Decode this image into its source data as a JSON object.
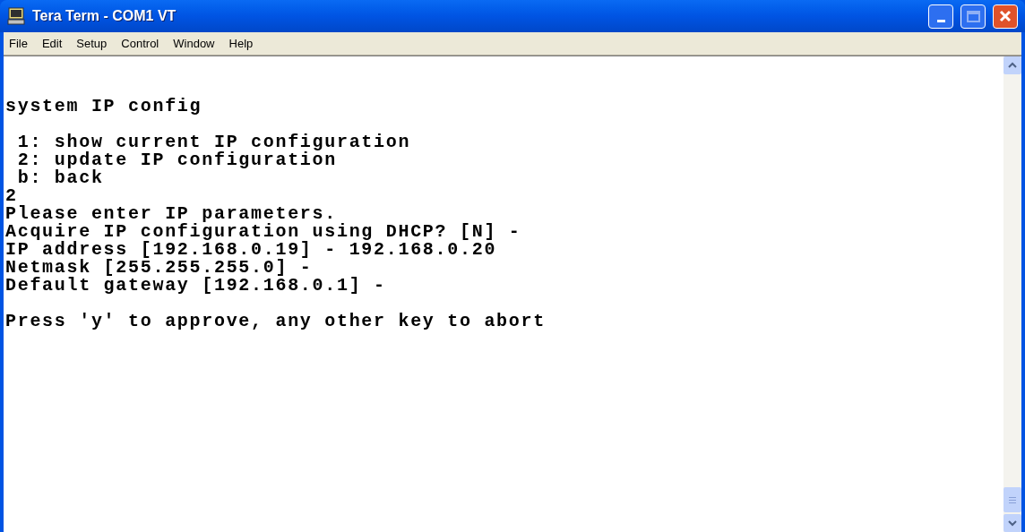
{
  "window": {
    "title": "Tera Term - COM1 VT"
  },
  "menu": [
    "File",
    "Edit",
    "Setup",
    "Control",
    "Window",
    "Help"
  ],
  "terminal": {
    "blocks": [
      {
        "lines": [
          "system IP config"
        ]
      },
      {
        "lines": [
          " 1: show current IP configuration",
          " 2: update IP configuration",
          " b: back",
          "2",
          "Please enter IP parameters.",
          "Acquire IP configuration using DHCP? [N] -",
          "IP address [192.168.0.19] - 192.168.0.20",
          "Netmask [255.255.255.0] -",
          "Default gateway [192.168.0.1] -"
        ]
      },
      {
        "lines": [
          "Press 'y' to approve, any other key to abort"
        ]
      }
    ]
  }
}
